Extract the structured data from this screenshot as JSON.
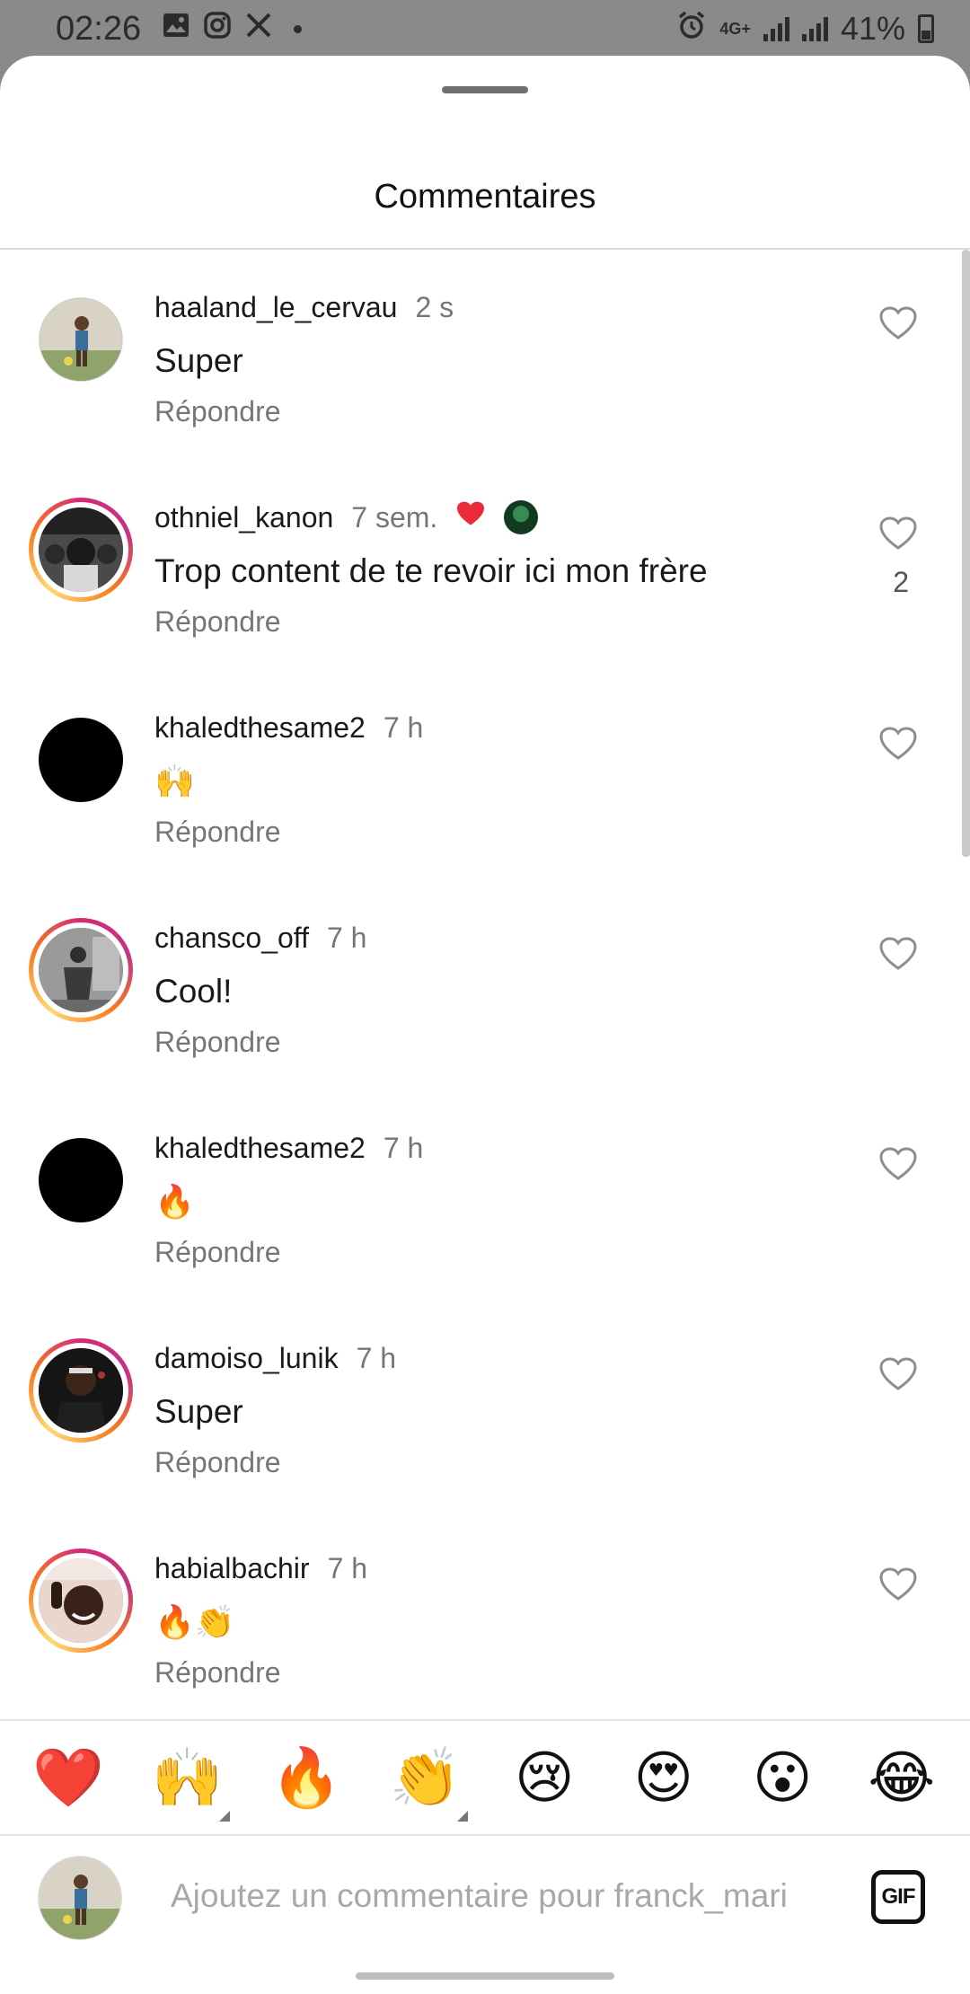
{
  "status_bar": {
    "time": "02:26",
    "battery": "41%",
    "network": "4G+"
  },
  "sheet": {
    "title": "Commentaires"
  },
  "comments": [
    {
      "username": "haaland_le_cervau",
      "time": "2 s",
      "text": "Super",
      "reply": "Répondre",
      "likes": "",
      "avatar": "photo-field",
      "ring": false
    },
    {
      "username": "othniel_kanon",
      "time": "7 sem.",
      "text": "Trop content de te revoir ici mon frère",
      "reply": "Répondre",
      "likes": "2",
      "avatar": "photo-group",
      "ring": true,
      "creator_liked": true
    },
    {
      "username": "khaledthesame2",
      "time": "7 h",
      "text": "🙌",
      "reply": "Répondre",
      "likes": "",
      "avatar": "black",
      "ring": false
    },
    {
      "username": "chansco_off",
      "time": "7 h",
      "text": "Cool!",
      "reply": "Répondre",
      "likes": "",
      "avatar": "photo-bw",
      "ring": true
    },
    {
      "username": "khaledthesame2",
      "time": "7 h",
      "text": "🔥",
      "reply": "Répondre",
      "likes": "",
      "avatar": "black",
      "ring": false
    },
    {
      "username": "damoiso_lunik",
      "time": "7 h",
      "text": "Super",
      "reply": "Répondre",
      "likes": "",
      "avatar": "photo-dark",
      "ring": true
    },
    {
      "username": "habialbachir",
      "time": "7 h",
      "text": "🔥👏",
      "reply": "Répondre",
      "likes": "",
      "avatar": "photo-selfie",
      "ring": true
    }
  ],
  "emoji_bar": [
    "❤️",
    "🙌",
    "🔥",
    "👏",
    "😢",
    "😍",
    "😮",
    "😂"
  ],
  "composer": {
    "placeholder": "Ajoutez un commentaire pour franck_mari",
    "gif_label": "GIF"
  },
  "colors": {
    "accent_heart": "#ed2a3c",
    "muted_text": "#767676",
    "status_bar_bg": "#8a8a8a"
  }
}
